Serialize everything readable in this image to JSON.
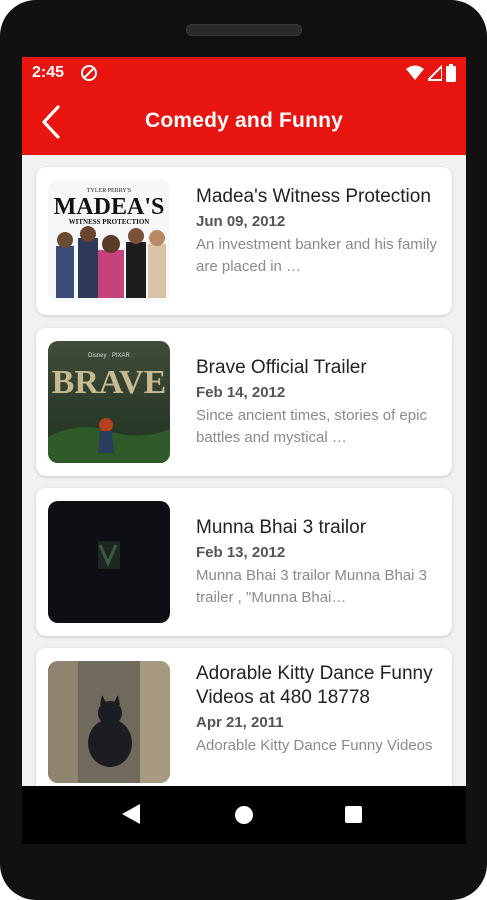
{
  "status_bar": {
    "time": "2:45"
  },
  "app_bar": {
    "title": "Comedy and Funny"
  },
  "videos": [
    {
      "title": "Madea's Witness Protection",
      "date": "Jun 09, 2012",
      "description": "An investment banker and his family are placed in …",
      "thumb_text_top": "TYLER PERRY'S",
      "thumb_text_main": "MADEA'S",
      "thumb_text_sub": "WITNESS PROTECTION"
    },
    {
      "title": "Brave Official Trailer",
      "date": "Feb 14, 2012",
      "description": "Since ancient times, stories of epic battles and mystical …",
      "thumb_text_top": "Disney · PIXAR",
      "thumb_text_main": "BRAVE"
    },
    {
      "title": "Munna Bhai 3 trailor",
      "date": "Feb 13, 2012",
      "description": "Munna Bhai 3 trailor Munna Bhai 3 trailer , \"Munna Bhai…"
    },
    {
      "title": "Adorable Kitty Dance Funny Videos at 480 18778",
      "date": "Apr 21, 2011",
      "description": "Adorable Kitty Dance Funny Videos"
    }
  ],
  "colors": {
    "accent": "#e8140f"
  }
}
